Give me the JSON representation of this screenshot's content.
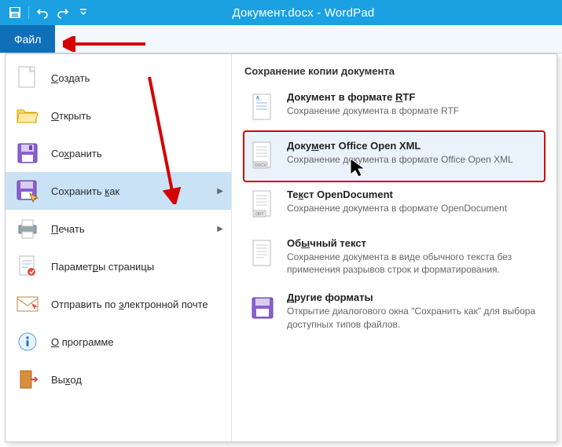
{
  "window": {
    "title": "Документ.docx - WordPad"
  },
  "qat": {
    "save": "save-icon",
    "undo": "undo-icon",
    "redo": "redo-icon",
    "customize": "customize-icon"
  },
  "file_tab": {
    "label": "Файл"
  },
  "menu": {
    "items": [
      {
        "id": "new",
        "label": "Создать"
      },
      {
        "id": "open",
        "label": "Открыть"
      },
      {
        "id": "save",
        "label": "Сохранить"
      },
      {
        "id": "saveas",
        "label": "Сохранить как",
        "submenu": true,
        "highlight": true
      },
      {
        "id": "print",
        "label": "Печать",
        "submenu": true
      },
      {
        "id": "pagesetup",
        "label": "Параметры страницы"
      },
      {
        "id": "send",
        "label": "Отправить по электронной почте"
      },
      {
        "id": "about",
        "label": "О программе"
      },
      {
        "id": "exit",
        "label": "Выход"
      }
    ]
  },
  "side": {
    "title": "Сохранение копии документа",
    "options": [
      {
        "id": "rtf",
        "title": "Документ в формате RTF",
        "desc": "Сохранение документа в формате RTF"
      },
      {
        "id": "ooxml",
        "title": "Документ Office Open XML",
        "desc": "Сохранение документа в формате Office Open XML",
        "highlight": true
      },
      {
        "id": "odt",
        "title": "Текст OpenDocument",
        "desc": "Сохранение документа в формате OpenDocument"
      },
      {
        "id": "txt",
        "title": "Обычный текст",
        "desc": "Сохранение документа в виде обычного текста без применения разрывов строк и форматирования."
      },
      {
        "id": "other",
        "title": "Другие форматы",
        "desc": "Открытие диалогового окна \"Сохранить как\" для выбора доступных типов файлов."
      }
    ]
  }
}
